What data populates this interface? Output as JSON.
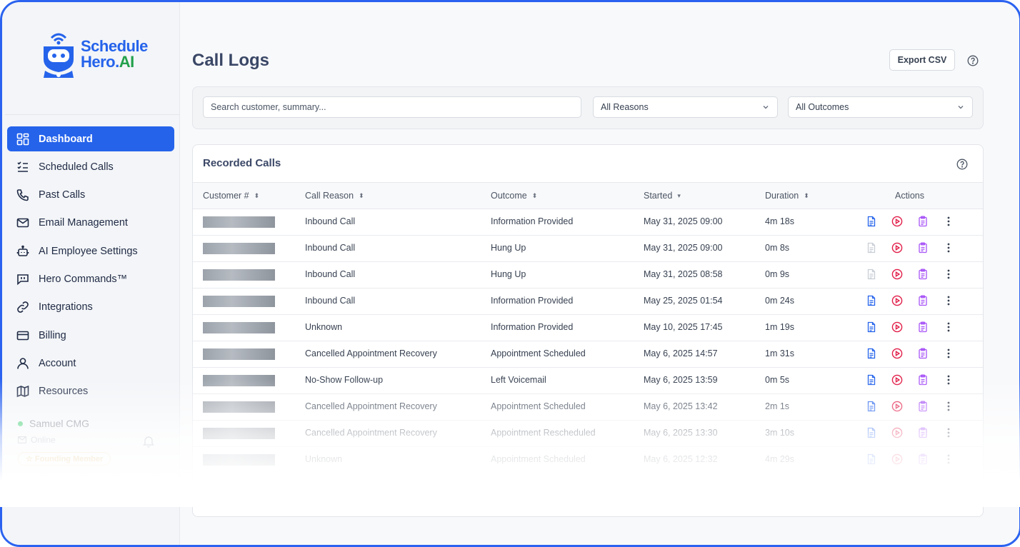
{
  "brand": {
    "line1": "Schedule",
    "line2_a": "Hero.",
    "line2_b": "AI"
  },
  "sidebar": {
    "items": [
      {
        "label": "Dashboard",
        "icon": "dashboard-grid-icon",
        "active": true
      },
      {
        "label": "Scheduled Calls",
        "icon": "checklist-icon"
      },
      {
        "label": "Past Calls",
        "icon": "phone-icon"
      },
      {
        "label": "Email Management",
        "icon": "mail-icon"
      },
      {
        "label": "AI Employee Settings",
        "icon": "robot-icon"
      },
      {
        "label": "Hero Commands™",
        "icon": "message-square-icon"
      },
      {
        "label": "Integrations",
        "icon": "link-icon"
      },
      {
        "label": "Billing",
        "icon": "credit-card-icon"
      },
      {
        "label": "Account",
        "icon": "user-icon"
      },
      {
        "label": "Resources",
        "icon": "map-icon"
      }
    ],
    "user": {
      "name": "Samuel CMG",
      "status": "Online",
      "badge": "Founding Member"
    }
  },
  "header": {
    "title": "Call Logs",
    "export_label": "Export CSV"
  },
  "filters": {
    "search_placeholder": "Search customer, summary...",
    "reason_value": "All Reasons",
    "outcome_value": "All Outcomes"
  },
  "table": {
    "title": "Recorded Calls",
    "columns": [
      "Customer #",
      "Call Reason",
      "Outcome",
      "Started",
      "Duration",
      "Actions"
    ],
    "rows": [
      {
        "reason": "Inbound Call",
        "outcome": "Information Provided",
        "started": "May 31, 2025 09:00",
        "duration": "4m 18s",
        "transcript": true
      },
      {
        "reason": "Inbound Call",
        "outcome": "Hung Up",
        "started": "May 31, 2025 09:00",
        "duration": "0m 8s",
        "transcript": false
      },
      {
        "reason": "Inbound Call",
        "outcome": "Hung Up",
        "started": "May 31, 2025 08:58",
        "duration": "0m 9s",
        "transcript": false
      },
      {
        "reason": "Inbound Call",
        "outcome": "Information Provided",
        "started": "May 25, 2025 01:54",
        "duration": "0m 24s",
        "transcript": true
      },
      {
        "reason": "Unknown",
        "outcome": "Information Provided",
        "started": "May 10, 2025 17:45",
        "duration": "1m 19s",
        "transcript": true
      },
      {
        "reason": "Cancelled Appointment Recovery",
        "outcome": "Appointment Scheduled",
        "started": "May 6, 2025 14:57",
        "duration": "1m 31s",
        "transcript": true
      },
      {
        "reason": "No-Show Follow-up",
        "outcome": "Left Voicemail",
        "started": "May 6, 2025 13:59",
        "duration": "0m 5s",
        "transcript": true
      },
      {
        "reason": "Cancelled Appointment Recovery",
        "outcome": "Appointment Scheduled",
        "started": "May 6, 2025 13:42",
        "duration": "2m 1s",
        "transcript": true
      },
      {
        "reason": "Cancelled Appointment Recovery",
        "outcome": "Appointment Rescheduled",
        "started": "May 6, 2025 13:30",
        "duration": "3m 10s",
        "transcript": true
      },
      {
        "reason": "Unknown",
        "outcome": "Appointment Scheduled",
        "started": "May 6, 2025 12:32",
        "duration": "4m 29s",
        "transcript": true
      }
    ]
  },
  "colors": {
    "accent": "#2563eb",
    "play": "#e11d48",
    "clipboard": "#a855f7",
    "brand_green": "#22a04b"
  }
}
